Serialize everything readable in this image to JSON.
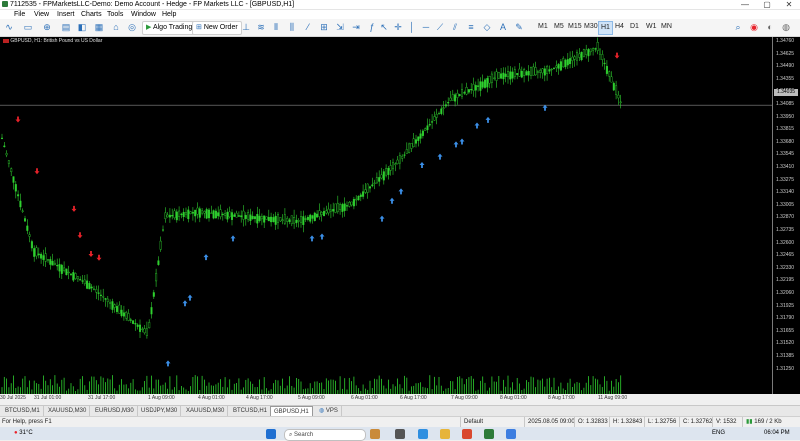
{
  "window": {
    "title": "7112535 - FPMarketsLLC-Demo: Demo Account - Hedge - FP Markets LLC - [GBPUSD,H1]",
    "minimize": "—",
    "maximize": "▢",
    "close": "✕"
  },
  "menu": [
    "File",
    "View",
    "Insert",
    "Charts",
    "Tools",
    "Window",
    "Help"
  ],
  "toolbar": {
    "algo_trading": "Algo Trading",
    "new_order": "New Order",
    "timeframes": [
      "M1",
      "M5",
      "M15",
      "M30",
      "H1",
      "H4",
      "D1",
      "W1",
      "MN"
    ],
    "active_timeframe": "H1"
  },
  "chart": {
    "label": "GBPUSD, H1:  British Pound vs US Dollar",
    "current_price": "1.34035",
    "y_ticks": [
      "1.34760",
      "1.34625",
      "1.34490",
      "1.34355",
      "1.34220",
      "1.34085",
      "1.33950",
      "1.33815",
      "1.33680",
      "1.33545",
      "1.33410",
      "1.33275",
      "1.33140",
      "1.33005",
      "1.32870",
      "1.32735",
      "1.32600",
      "1.32465",
      "1.32330",
      "1.32195",
      "1.32060",
      "1.31925",
      "1.31790",
      "1.31655",
      "1.31520",
      "1.31385",
      "1.31250"
    ],
    "x_ticks": [
      "30 Jul 2025",
      "31 Jul 01:00",
      "31 Jul 17:00",
      "1 Aug 09:00",
      "4 Aug 01:00",
      "4 Aug 17:00",
      "5 Aug 09:00",
      "6 Aug 01:00",
      "6 Aug 17:00",
      "7 Aug 09:00",
      "8 Aug 01:00",
      "8 Aug 17:00",
      "11 Aug 09:00"
    ]
  },
  "chart_data": {
    "type": "candlestick",
    "title": "GBPUSD, H1: British Pound vs US Dollar",
    "xlabel": "",
    "ylabel": "",
    "ylim": [
      1.3125,
      1.3476
    ],
    "x_range": [
      "30 Jul 2025",
      "11 Aug 09:00"
    ],
    "last_price": 1.34035,
    "price_path": [
      {
        "x": "30 Jul 2025",
        "y": 1.3376
      },
      {
        "x": "31 Jul 01:00",
        "y": 1.3248
      },
      {
        "x": "31 Jul 17:00",
        "y": 1.3213
      },
      {
        "x": "1 Aug 09:00",
        "y": 1.316
      },
      {
        "x": "1 Aug 09:00",
        "y": 1.3285
      },
      {
        "x": "4 Aug 01:00",
        "y": 1.329
      },
      {
        "x": "4 Aug 17:00",
        "y": 1.3285
      },
      {
        "x": "5 Aug 09:00",
        "y": 1.328
      },
      {
        "x": "6 Aug 01:00",
        "y": 1.3298
      },
      {
        "x": "6 Aug 17:00",
        "y": 1.3345
      },
      {
        "x": "7 Aug 09:00",
        "y": 1.341
      },
      {
        "x": "8 Aug 01:00",
        "y": 1.3435
      },
      {
        "x": "8 Aug 17:00",
        "y": 1.344
      },
      {
        "x": "11 Aug 09:00",
        "y": 1.3465
      },
      {
        "x": "11 Aug 09:00",
        "y": 1.3403
      }
    ],
    "series": [
      {
        "name": "Buy arrows",
        "color": "#3b8fe8"
      },
      {
        "name": "Sell arrows",
        "color": "#e8222a"
      }
    ],
    "grid": false
  },
  "tabs": [
    "BTCUSD,M1",
    "XAUUSD,M30",
    "EURUSD,M30",
    "USDJPY,M30",
    "XAUUSD,M30",
    "BTCUSD,H1",
    "GBPUSD,H1",
    "VPS"
  ],
  "active_tab": "GBPUSD,H1",
  "status": {
    "help": "For Help, press F1",
    "profile": "Default",
    "time": "2025.08.05 09:00",
    "open": "O: 1.32833",
    "high": "H: 1.32843",
    "low": "L: 1.32756",
    "close": "C: 1.32762",
    "volume": "V: 1532",
    "traffic": "169 / 2 Kb"
  },
  "taskbar": {
    "weather": "31°C",
    "search_placeholder": "Search",
    "language": "ENG",
    "clock": "06:04 PM"
  },
  "colors": {
    "candle": "#2fd12f",
    "buy_arrow": "#3b8fe8",
    "sell_arrow": "#e8222a",
    "background": "#000000"
  }
}
